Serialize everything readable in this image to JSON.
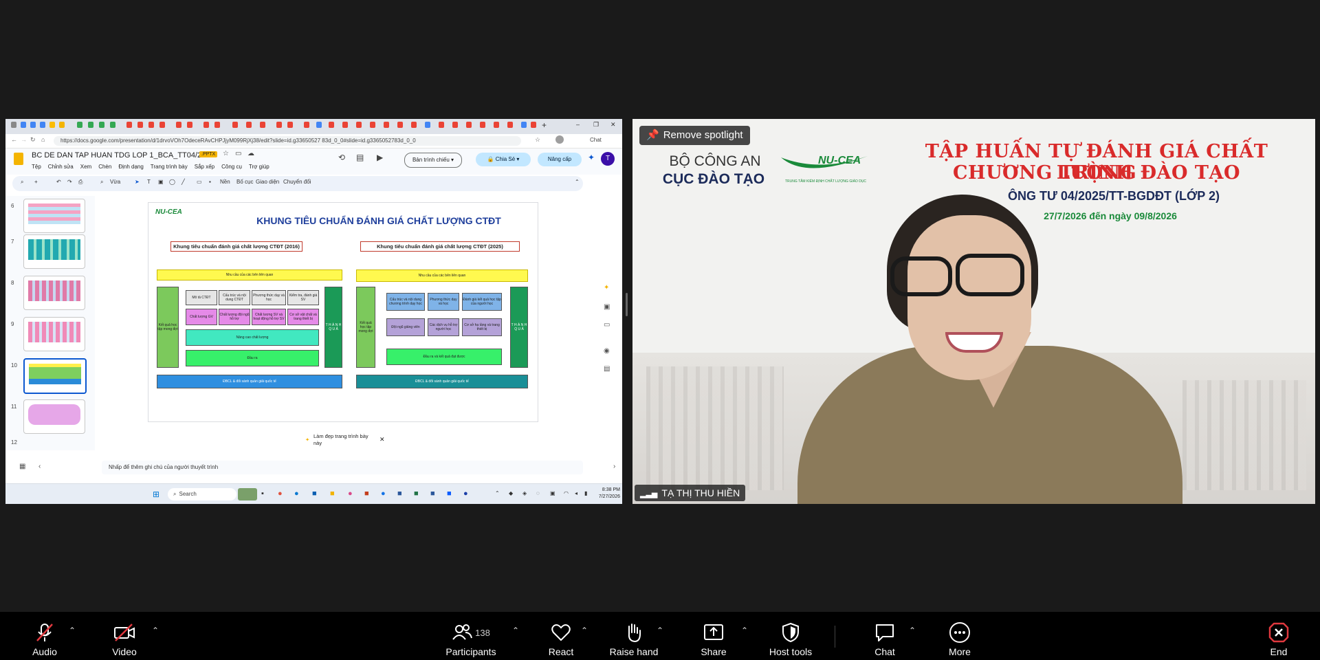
{
  "browser": {
    "url": "https://docs.google.com/presentation/d/1drvoVOh7OdeceRAvCHPJjyM099RjXj38/edit?slide=id.g33650527 83d_0_0#slide=id.g3365052783d_0_0",
    "chat_extension": "Chat"
  },
  "slides_app": {
    "doc_title": "BC DE DAN TAP HUAN TDG LOP 1_BCA_TT04/2025",
    "file_badge": ".PPTX",
    "menu": [
      "Tệp",
      "Chỉnh sửa",
      "Xem",
      "Chèn",
      "Định dạng",
      "Trang trình bày",
      "Sắp xếp",
      "Công cụ",
      "Trợ giúp"
    ],
    "slideshow_label": "Bản trình chiếu",
    "share_label": "Chia Sẻ",
    "upgrade_label": "Nâng cấp",
    "avatar_letter": "T",
    "toolbar": {
      "zoom": "Vừa",
      "background": "Nền",
      "layout": "Bố cục",
      "theme": "Giao diện",
      "transition": "Chuyển đổi"
    },
    "thumbnail_numbers": [
      "6",
      "7",
      "8",
      "9",
      "10",
      "11",
      "12"
    ],
    "notes_placeholder": "Nhấp để thêm ghi chú của người thuyết trình",
    "beautify_tip": "Làm đẹp trang trình bày này"
  },
  "slide": {
    "logo_text": "NU-CEA",
    "title": "KHUNG TIÊU CHUẨN ĐÁNH GIÁ CHẤT LƯỢNG CTĐT",
    "left": {
      "header": "Khung tiêu chuẩn đánh giá chất lượng CTĐT (2016)",
      "top_bar": "Nhu cầu của các bên liên quan",
      "side": "Kết quả học tập mong đợi",
      "right_side": "T H À N H Q U Ả",
      "row1": [
        "Mô tả CTĐT",
        "Cấu trúc và nội dung CTĐT",
        "Phương thức dạy và học",
        "Kiểm tra, đánh giá SV"
      ],
      "row2": [
        "Chất lượng GV",
        "Chất lượng đội ngũ hỗ trợ",
        "Chất lượng SV và hoạt động hỗ trợ SV",
        "Cơ sở vật chất và trang thiết bị"
      ],
      "improve": "Nâng cao chất lượng",
      "output": "Đầu ra",
      "bottom_bar": "ĐBCL & đổi sánh quản giải quốc tế"
    },
    "right": {
      "header": "Khung tiêu chuẩn đánh giá chất lượng CTĐT (2025)",
      "top_bar": "Nhu cầu của các bên liên quan",
      "side": "Kết quả học tập mong đợi",
      "right_side": "T H À N H Q U Ả",
      "row1": [
        "Cấu trúc và nội dung chương trình dạy học",
        "Phương thức dạy và học",
        "Đánh giá kết quả học tập của người học"
      ],
      "row2": [
        "Đội ngũ giảng viên",
        "Các dịch vụ hỗ trợ người học",
        "Cơ sở hạ tầng và trang thiết bị"
      ],
      "output": "Đầu ra và kết quả đạt được",
      "bottom_bar": "ĐBCL & đổi sánh quản giải quốc tế"
    }
  },
  "taskbar": {
    "search": "Search",
    "time": "8:38 PM",
    "date": "7/27/2026"
  },
  "video": {
    "spotlight_label": "Remove spotlight",
    "participant_name": "TẠ THỊ THU HIỀN",
    "banner": {
      "org_line1": "BỘ CÔNG AN",
      "org_line2": "CỤC ĐÀO TẠO",
      "logo_text": "NU-CEA",
      "logo_sub": "TRUNG TÂM KIỂM ĐỊNH CHẤT LƯỢNG GIÁO DỤC",
      "title_line1": "TẬP HUẤN TỰ ĐÁNH GIÁ CHẤT LƯỢNG",
      "title_line2": "CHƯƠNG TRÌNH ĐÀO TẠO",
      "subtitle": "ÔNG TƯ 04/2025/TT-BGDĐT (LỚP 2)",
      "dates": "27/7/2026 đến ngày 09/8/2026"
    }
  },
  "controls": {
    "audio": "Audio",
    "video": "Video",
    "participants": "Participants",
    "participant_count": "138",
    "react": "React",
    "raise_hand": "Raise hand",
    "share": "Share",
    "host_tools": "Host tools",
    "chat": "Chat",
    "more": "More",
    "end": "End"
  },
  "colors": {
    "end_red": "#e0383e",
    "title_red": "#d92b2b",
    "banner_green": "#1a8a3a",
    "slide_title_blue": "#1f3f9c",
    "accent_blue": "#0b57d0"
  }
}
